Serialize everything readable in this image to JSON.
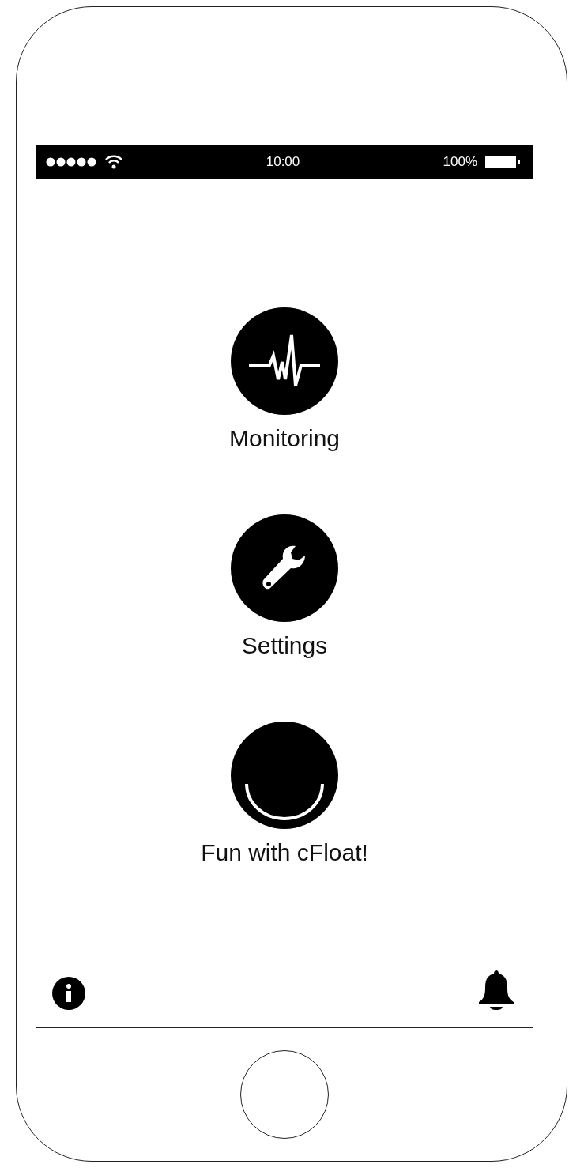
{
  "status_bar": {
    "time": "10:00",
    "battery": "100%"
  },
  "menu": [
    {
      "kind": "pulse",
      "label": "Monitoring"
    },
    {
      "kind": "wrench",
      "label": "Settings"
    },
    {
      "kind": "smile",
      "label": "Fun with cFloat!"
    }
  ]
}
